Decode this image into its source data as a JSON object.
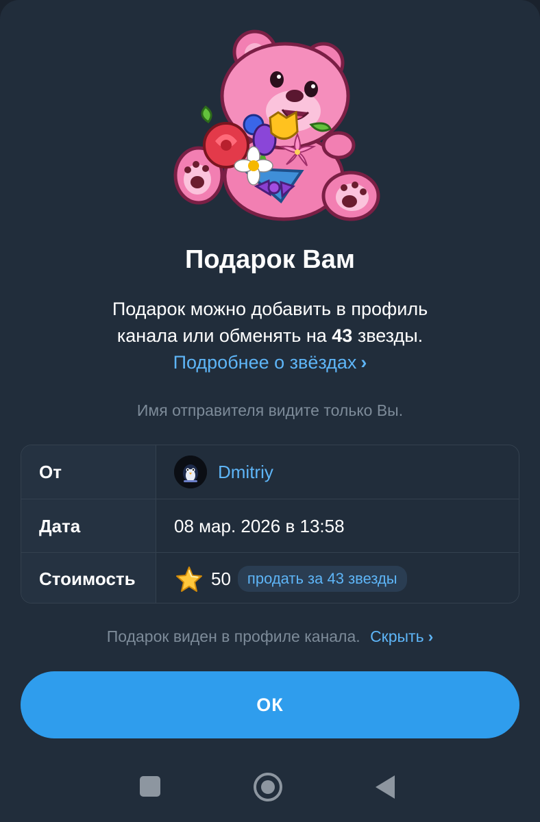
{
  "gift": {
    "sticker_icon": "pink-teddy-bear-with-flower-bouquet",
    "title": "Подарок Вам",
    "description_line1": "Подарок можно добавить в профиль",
    "description_line2_pre": "канала или обменять на",
    "description_line2_amount": "43",
    "description_line2_post": "звезды.",
    "learn_more_link": "Подробнее о звёздах",
    "sender_note": "Имя отправителя видите только Вы."
  },
  "details": {
    "from_label": "От",
    "from_value": "Dmitriy",
    "date_label": "Дата",
    "date_value": "08 мар. 2026 в 13:58",
    "cost_label": "Стоимость",
    "cost_value": "50",
    "sell_button": "продать за 43 звезды"
  },
  "footer": {
    "visibility_text": "Подарок виден в профиле канала.",
    "hide_link": "Скрыть",
    "ok_button": "ОК"
  },
  "colors": {
    "background": "#212d3b",
    "accent": "#2f9ded",
    "link": "#5eb5f7",
    "muted_text": "#7d8b99"
  }
}
